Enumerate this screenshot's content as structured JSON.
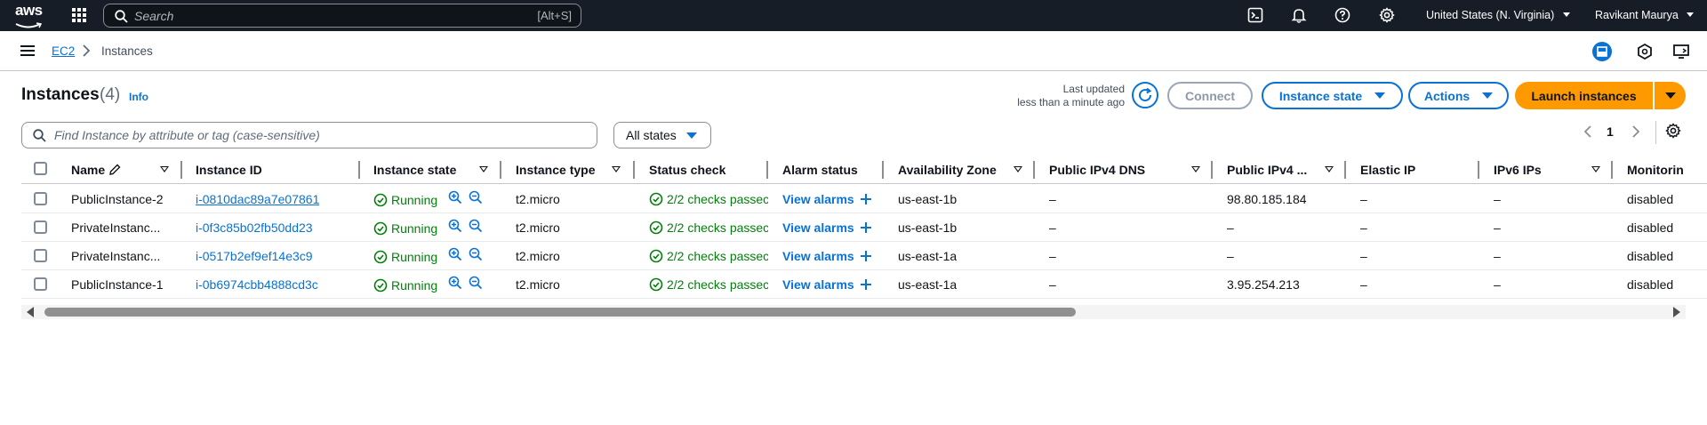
{
  "topnav": {
    "logo": "aws",
    "search_placeholder": "Search",
    "search_shortcut": "[Alt+S]",
    "region": "United States (N. Virginia)",
    "user": "Ravikant Maurya"
  },
  "breadcrumb": {
    "service": "EC2",
    "current": "Instances"
  },
  "header": {
    "title": "Instances",
    "count": "(4)",
    "info": "Info",
    "last_updated_label": "Last updated",
    "last_updated_value": "less than a minute ago",
    "connect": "Connect",
    "instance_state": "Instance state",
    "actions": "Actions",
    "launch": "Launch instances"
  },
  "filter": {
    "placeholder": "Find Instance by attribute or tag (case-sensitive)",
    "states_value": "All states"
  },
  "pagination": {
    "current_page": "1"
  },
  "table": {
    "columns": [
      "Name",
      "Instance ID",
      "Instance state",
      "Instance type",
      "Status check",
      "Alarm status",
      "Availability Zone",
      "Public IPv4 DNS",
      "Public IPv4 ...",
      "Elastic IP",
      "IPv6 IPs",
      "Monitorin"
    ],
    "rows": [
      {
        "name": "PublicInstance-2",
        "id": "i-0810dac89a7e07861",
        "state": "Running",
        "type": "t2.micro",
        "status": "2/2 checks passec",
        "alarm": "View alarms",
        "az": "us-east-1b",
        "dns": "–",
        "ipv4": "98.80.185.184",
        "eip": "–",
        "ipv6": "–",
        "monitoring": "disabled"
      },
      {
        "name": "PrivateInstanc...",
        "id": "i-0f3c85b02fb50dd23",
        "state": "Running",
        "type": "t2.micro",
        "status": "2/2 checks passec",
        "alarm": "View alarms",
        "az": "us-east-1b",
        "dns": "–",
        "ipv4": "–",
        "eip": "–",
        "ipv6": "–",
        "monitoring": "disabled"
      },
      {
        "name": "PrivateInstanc...",
        "id": "i-0517b2ef9ef14e3c9",
        "state": "Running",
        "type": "t2.micro",
        "status": "2/2 checks passec",
        "alarm": "View alarms",
        "az": "us-east-1a",
        "dns": "–",
        "ipv4": "–",
        "eip": "–",
        "ipv6": "–",
        "monitoring": "disabled"
      },
      {
        "name": "PublicInstance-1",
        "id": "i-0b6974cbb4888cd3c",
        "state": "Running",
        "type": "t2.micro",
        "status": "2/2 checks passec",
        "alarm": "View alarms",
        "az": "us-east-1a",
        "dns": "–",
        "ipv4": "3.95.254.213",
        "eip": "–",
        "ipv6": "–",
        "monitoring": "disabled"
      }
    ]
  },
  "colors": {
    "nav_bg": "#161d26",
    "link": "#0972d3",
    "primary": "#ff9900",
    "success": "#037f0c"
  }
}
